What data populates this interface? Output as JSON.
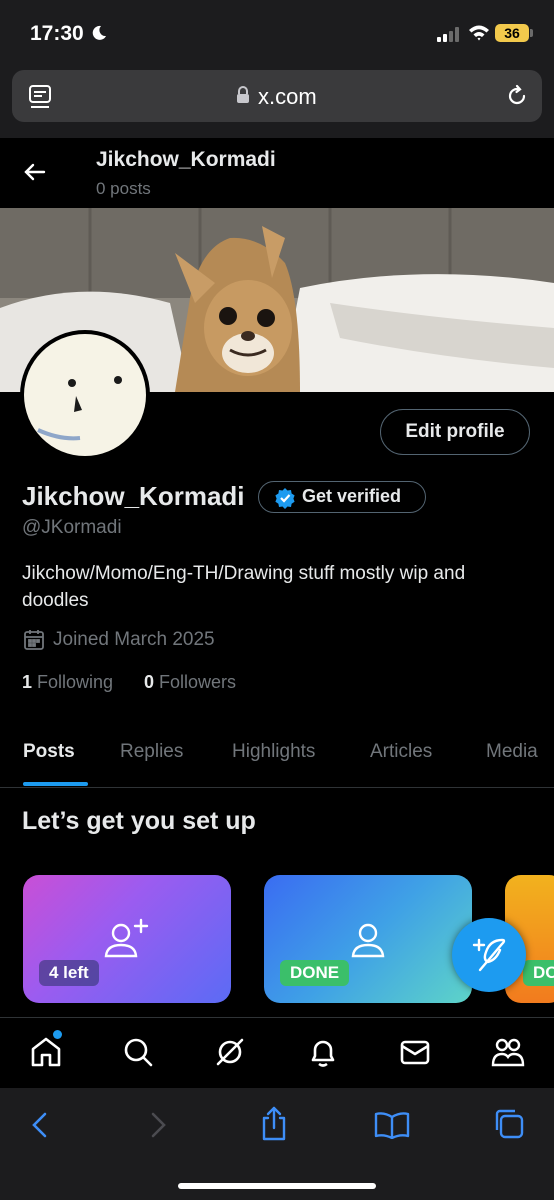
{
  "status_bar": {
    "time": "17:30",
    "battery": "36"
  },
  "browser": {
    "url": "x.com"
  },
  "header": {
    "name": "Jikchow_Kormadi",
    "posts_count": "0 posts"
  },
  "profile": {
    "display_name": "Jikchow_Kormadi",
    "handle": "@JKormadi",
    "bio": "Jikchow/Momo/Eng-TH/Drawing stuff mostly wip and doodles",
    "joined": "Joined March 2025",
    "following_count": "1",
    "following_label": "Following",
    "followers_count": "0",
    "followers_label": "Followers",
    "edit_label": "Edit profile",
    "verify_label": "Get verified"
  },
  "tabs": [
    {
      "label": "Posts",
      "active": true
    },
    {
      "label": "Replies"
    },
    {
      "label": "Highlights"
    },
    {
      "label": "Articles"
    },
    {
      "label": "Media"
    }
  ],
  "setup": {
    "title": "Let’s get you set up",
    "cards": [
      {
        "badge": "4 left",
        "icon": "person-add-icon"
      },
      {
        "badge": "DONE",
        "icon": "person-icon"
      },
      {
        "badge": "DONE"
      }
    ]
  },
  "bottom_nav": [
    "home-icon",
    "search-icon",
    "grok-icon",
    "notifications-icon",
    "messages-icon",
    "communities-icon"
  ],
  "safari_toolbar": [
    "back-icon",
    "forward-icon",
    "share-icon",
    "bookmarks-icon",
    "tabs-icon"
  ],
  "colors": {
    "accent": "#1d9bf0",
    "background": "#000000",
    "secondary_text": "#71767b",
    "done_green": "#3bbf6a"
  }
}
